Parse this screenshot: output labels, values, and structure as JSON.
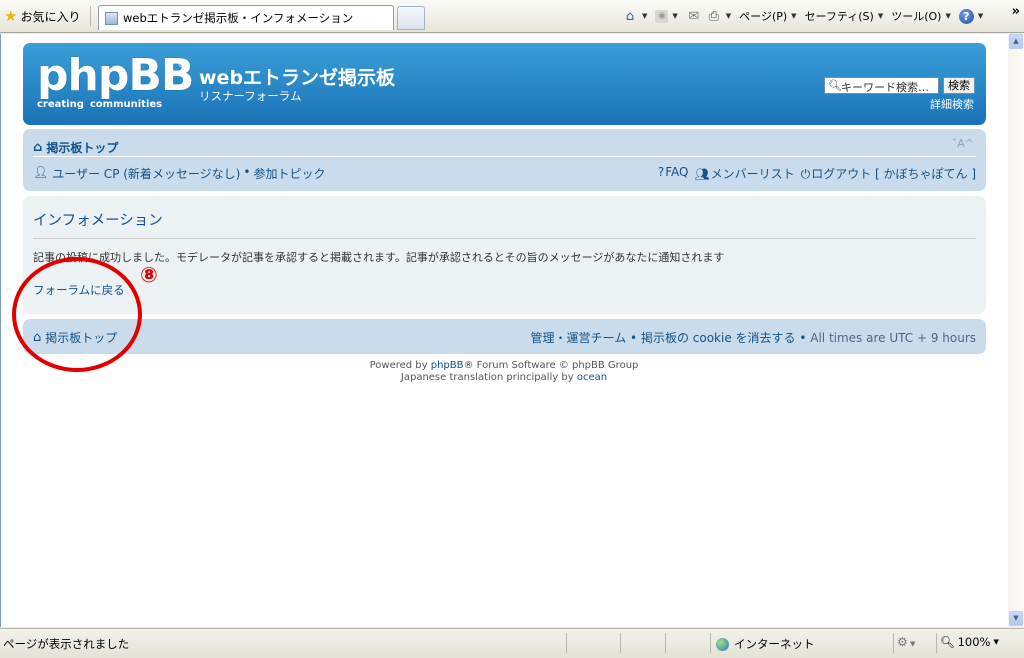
{
  "browser": {
    "favorites_label": "お気に入り",
    "tab_title": "webエトランゼ掲示板・インフォメーション",
    "tools": {
      "page_label": "ページ(P)",
      "safety_label": "セーフティ(S)",
      "tools_label": "ツール(O)"
    },
    "chevron": "»"
  },
  "header": {
    "logo_text": "phpBB",
    "logo_reg": "®",
    "logo_tag_1": "creating",
    "logo_tag_2": "communities",
    "site_title": "webエトランゼ掲示板",
    "site_description": "リスナーフォーラム",
    "search_placeholder": "キーワード検索…",
    "search_button": "検索",
    "advanced_search": "詳細検索"
  },
  "navbar": {
    "breadcrumb_home": "掲示板トップ",
    "font_size_toggle": "ˇA^",
    "user_cp": "ユーザー CP (新着メッセージなし)",
    "bullet": "•",
    "participated_topics": "参加トピック",
    "faq": "FAQ",
    "member_list": "メンバーリスト",
    "logout": "ログアウト [ かぼちゃぽてん ]"
  },
  "panel": {
    "title": "インフォメーション",
    "message": "記事の投稿に成功しました。モデレータが記事を承認すると掲載されます。記事が承認されるとその旨のメッセージがあなたに通知されます",
    "return_link": "フォーラムに戻る"
  },
  "footer_nav": {
    "home": "掲示板トップ",
    "team": "管理・運営チーム",
    "bullet": "•",
    "delete_cookies": "掲示板の cookie を消去する",
    "timezone": "All times are UTC + 9 hours"
  },
  "copyright": {
    "line1_a": "Powered by ",
    "line1_link": "phpBB",
    "line1_b": "® Forum Software © phpBB Group",
    "line2_a": "Japanese translation principally by ",
    "line2_link": "ocean"
  },
  "annotation": {
    "step_number": "⑧",
    "color": "#e00000"
  },
  "statusbar": {
    "status_text": "ページが表示されました",
    "zone": "インターネット",
    "zoom": "100%"
  },
  "colors": {
    "header_blue": "#1a73b8",
    "nav_bg": "#cadceb",
    "panel_bg": "#ecf1f3",
    "link": "#105289"
  }
}
